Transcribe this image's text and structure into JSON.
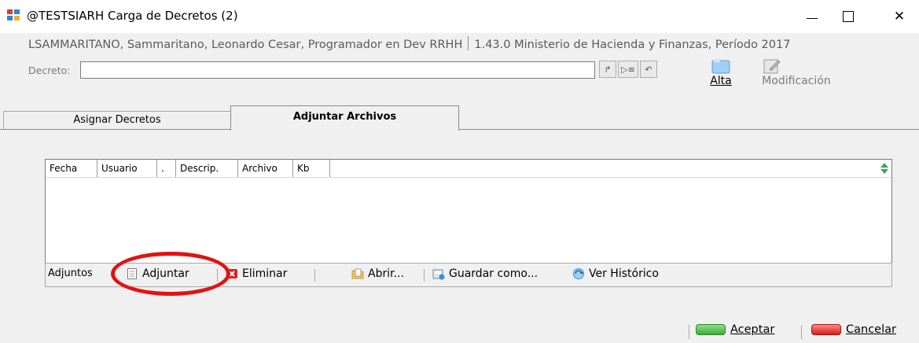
{
  "window": {
    "title": "@TESTSIARH Carga de Decretos (2)",
    "close_glyph": "✕",
    "minimize_icon": "minimize-icon",
    "maximize_icon": "maximize-icon",
    "close_icon": "close-icon"
  },
  "user_info": {
    "user": "LSAMMARITANO, Sammaritano, Leonardo Cesar, Programador en Dev RRHH",
    "version": "1.43.0 Ministerio de Hacienda y Finanzas, Período 2017"
  },
  "decreto": {
    "label": "Decreto:",
    "value": "",
    "nav": [
      "↱",
      "▷≡",
      "↶"
    ]
  },
  "toolbar": {
    "alta_label": "Alta",
    "modificacion_label": "Modificación"
  },
  "tabs": [
    {
      "label": "Asignar Decretos",
      "active": false
    },
    {
      "label": "Adjuntar Archivos",
      "active": true
    }
  ],
  "grid": {
    "columns": [
      "Fecha",
      "Usuario",
      ".",
      "Descrip.",
      "Archivo",
      "Kb"
    ],
    "rows": []
  },
  "attachments_toolbar": {
    "label": "Adjuntos",
    "adjuntar": "Adjuntar",
    "eliminar": "Eliminar",
    "abrir": "Abrir...",
    "guardar": "Guardar como...",
    "historico": "Ver Histórico"
  },
  "buttons": {
    "aceptar": "Aceptar",
    "cancelar": "Cancelar"
  },
  "colors": {
    "accent_alta": "#7fb9e6",
    "aceptar_green": "#46b33c",
    "cancelar_red": "#e02020",
    "highlight_circle": "#e31212"
  }
}
